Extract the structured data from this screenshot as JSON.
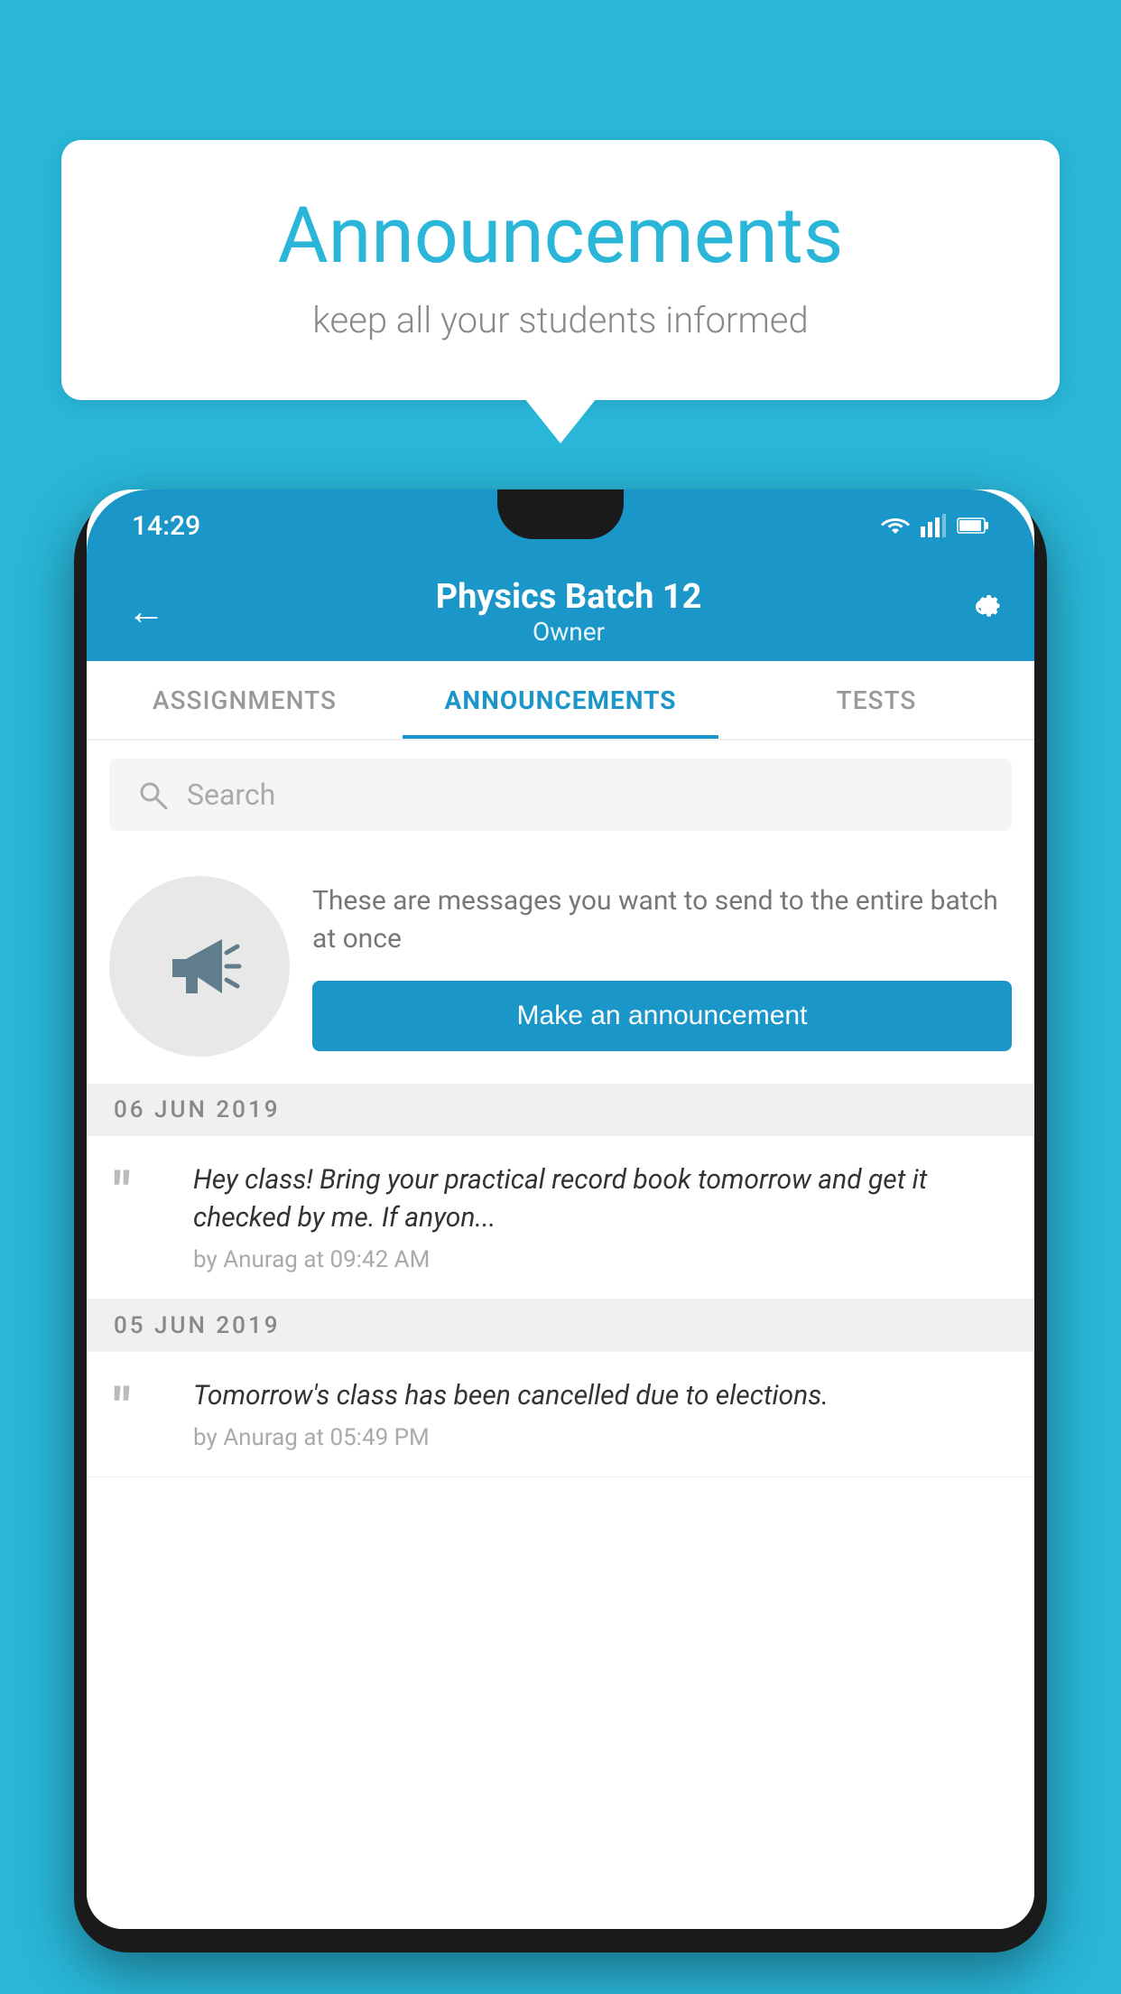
{
  "background_color": "#29b6d8",
  "speech_bubble": {
    "title": "Announcements",
    "subtitle": "keep all your students informed"
  },
  "phone": {
    "status_bar": {
      "time": "14:29",
      "icons": [
        "wifi",
        "signal",
        "battery"
      ]
    },
    "toolbar": {
      "title": "Physics Batch 12",
      "subtitle": "Owner",
      "back_label": "←",
      "settings_label": "⚙"
    },
    "tabs": [
      {
        "label": "ASSIGNMENTS",
        "active": false
      },
      {
        "label": "ANNOUNCEMENTS",
        "active": true
      },
      {
        "label": "TESTS",
        "active": false
      }
    ],
    "search": {
      "placeholder": "Search"
    },
    "promo": {
      "description": "These are messages you want to send to the entire batch at once",
      "button_label": "Make an announcement"
    },
    "announcements": [
      {
        "date": "06  JUN  2019",
        "message": "Hey class! Bring your practical record book tomorrow and get it checked by me. If anyon...",
        "meta": "by Anurag at 09:42 AM"
      },
      {
        "date": "05  JUN  2019",
        "message": "Tomorrow's class has been cancelled due to elections.",
        "meta": "by Anurag at 05:49 PM"
      }
    ]
  }
}
